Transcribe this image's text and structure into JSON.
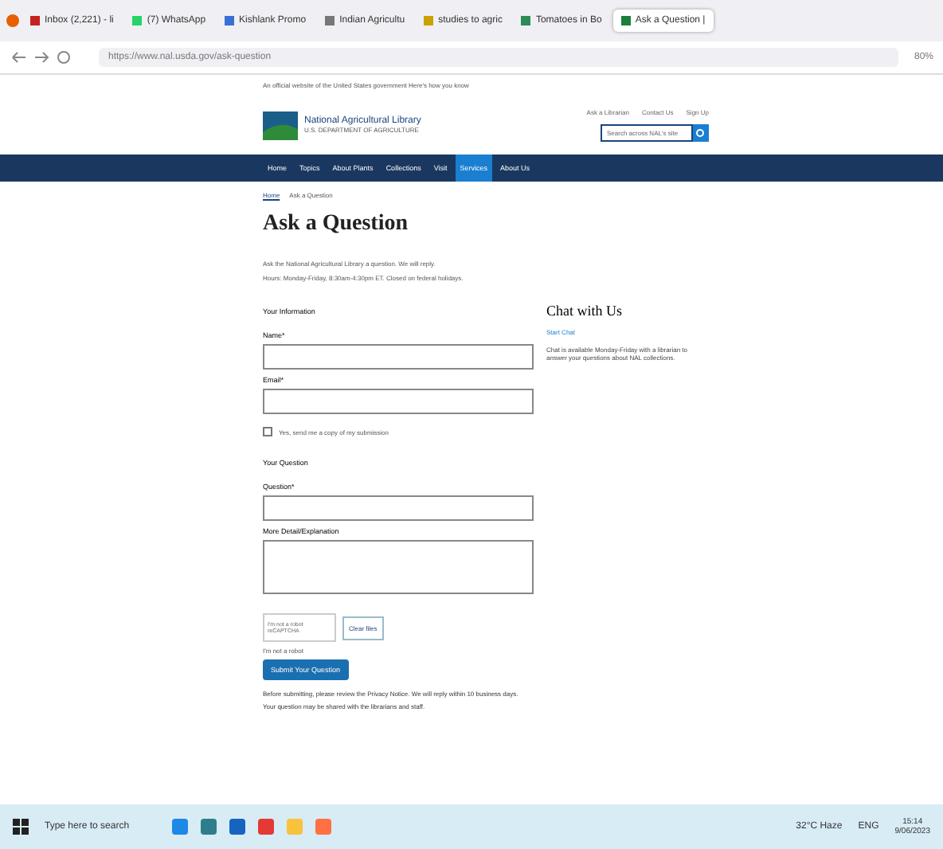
{
  "tabs": [
    {
      "label": "Inbox (2,221) - li",
      "color": "#c5221f",
      "selected": false
    },
    {
      "label": "(7) WhatsApp",
      "color": "#25d366",
      "selected": false
    },
    {
      "label": "Kishlank Promo",
      "color": "#3b6fd6",
      "selected": false
    },
    {
      "label": "Indian Agricultu",
      "color": "#777777",
      "selected": false
    },
    {
      "label": "studies to agric",
      "color": "#c8a200",
      "selected": false
    },
    {
      "label": "Tomatoes in Bo",
      "color": "#2e8b57",
      "selected": false
    },
    {
      "label": "Ask a Question |",
      "color": "#1b7f3b",
      "selected": true
    }
  ],
  "address": {
    "url": "https://www.nal.usda.gov/ask-question",
    "zoom": "80%"
  },
  "page": {
    "banner": "An official website of the United States government  Here's how you know",
    "logo": {
      "title": "National Agricultural Library",
      "subtitle": "U.S. DEPARTMENT OF AGRICULTURE"
    },
    "header_links": [
      "Ask a Librarian",
      "Contact Us",
      "Sign Up"
    ],
    "search": {
      "placeholder": "Search across NAL's site"
    },
    "nav": [
      {
        "label": "Home",
        "selected": false
      },
      {
        "label": "Topics",
        "selected": false
      },
      {
        "label": "About Plants",
        "selected": false
      },
      {
        "label": "Collections",
        "selected": false
      },
      {
        "label": "Visit",
        "selected": false
      },
      {
        "label": "Services",
        "selected": true
      },
      {
        "label": "About Us",
        "selected": false
      }
    ],
    "breadcrumb": [
      "Home",
      "Ask a Question"
    ],
    "title": "Ask a Question",
    "intro": [
      "Ask the National Agricultural Library a question. We will reply.",
      "Hours: Monday-Friday, 8:30am-4:30pm ET. Closed on federal holidays."
    ],
    "form": {
      "section1": "Your Information",
      "name_label": "Name*",
      "email_label": "Email*",
      "copy_checkbox": {
        "label": "Yes, send me a copy of my submission",
        "checked": false
      },
      "section2": "Your Question",
      "question_label": "Question*",
      "detail_label": "More Detail/Explanation",
      "captcha": {
        "text": "I'm not a robot  reCAPTCHA",
        "button": "Clear files"
      },
      "captcha_note": "I'm not a robot",
      "submit": "Submit Your Question",
      "footnote": [
        "Before submitting, please review the Privacy Notice. We will reply within 10 business days.",
        "Your question may be shared with the librarians and staff."
      ]
    },
    "chat": {
      "title": "Chat with Us",
      "link": "Start Chat",
      "text": "Chat is available Monday-Friday with a librarian to answer your questions about NAL collections."
    }
  },
  "taskbar": {
    "search_placeholder": "Type here to search",
    "weather": "32°C Haze",
    "lang": "ENG",
    "time": "15:14",
    "date": "9/06/2023"
  }
}
